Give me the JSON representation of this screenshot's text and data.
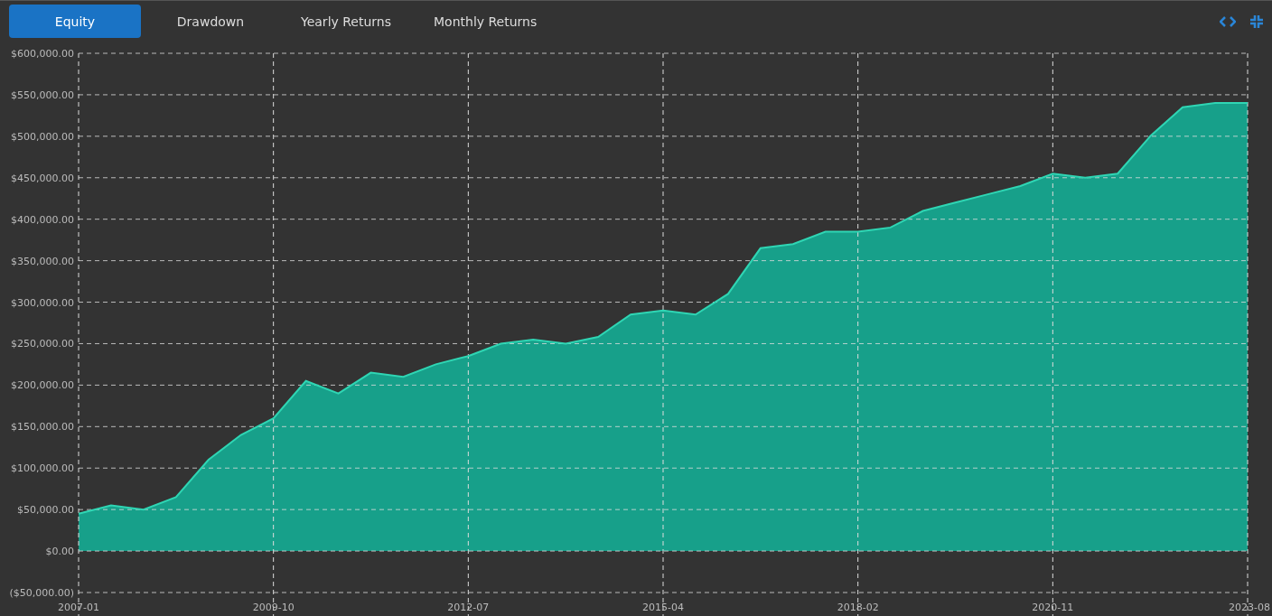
{
  "tabs": [
    {
      "label": "Equity",
      "selected": true
    },
    {
      "label": "Drawdown",
      "selected": false
    },
    {
      "label": "Yearly Returns",
      "selected": false
    },
    {
      "label": "Monthly Returns",
      "selected": false
    }
  ],
  "chart_data": {
    "type": "area",
    "categories": [
      "2007-01",
      null,
      null,
      null,
      null,
      null,
      "2009-10",
      null,
      null,
      null,
      null,
      null,
      "2012-07",
      null,
      null,
      null,
      null,
      null,
      "2015-04",
      null,
      null,
      null,
      null,
      null,
      "2018-02",
      null,
      null,
      null,
      null,
      null,
      "2020-11",
      null,
      null,
      null,
      null,
      null,
      "2023-08"
    ],
    "series": [
      {
        "color": "#17a08a",
        "values": [
          45000,
          55000,
          50000,
          65000,
          110000,
          140000,
          160000,
          205000,
          190000,
          215000,
          210000,
          225000,
          235000,
          250000,
          255000,
          250000,
          258000,
          285000,
          290000,
          285000,
          310000,
          365000,
          370000,
          385000,
          385000,
          390000,
          410000,
          420000,
          430000,
          440000,
          455000,
          450000,
          455000,
          500000,
          535000,
          540000,
          540000
        ]
      }
    ],
    "ylim": [
      -50000,
      600000
    ],
    "grid": true,
    "yticks": [
      {
        "value": -50000,
        "label": "($50,000.00)"
      },
      {
        "value": 0,
        "label": "$0.00"
      },
      {
        "value": 50000,
        "label": "$50,000.00"
      },
      {
        "value": 100000,
        "label": "$100,000.00"
      },
      {
        "value": 150000,
        "label": "$150,000.00"
      },
      {
        "value": 200000,
        "label": "$200,000.00"
      },
      {
        "value": 250000,
        "label": "$250,000.00"
      },
      {
        "value": 300000,
        "label": "$300,000.00"
      },
      {
        "value": 350000,
        "label": "$350,000.00"
      },
      {
        "value": 400000,
        "label": "$400,000.00"
      },
      {
        "value": 450000,
        "label": "$450,000.00"
      },
      {
        "value": 500000,
        "label": "$500,000.00"
      },
      {
        "value": 550000,
        "label": "$550,000.00"
      },
      {
        "value": 600000,
        "label": "$600,000.00"
      }
    ]
  }
}
